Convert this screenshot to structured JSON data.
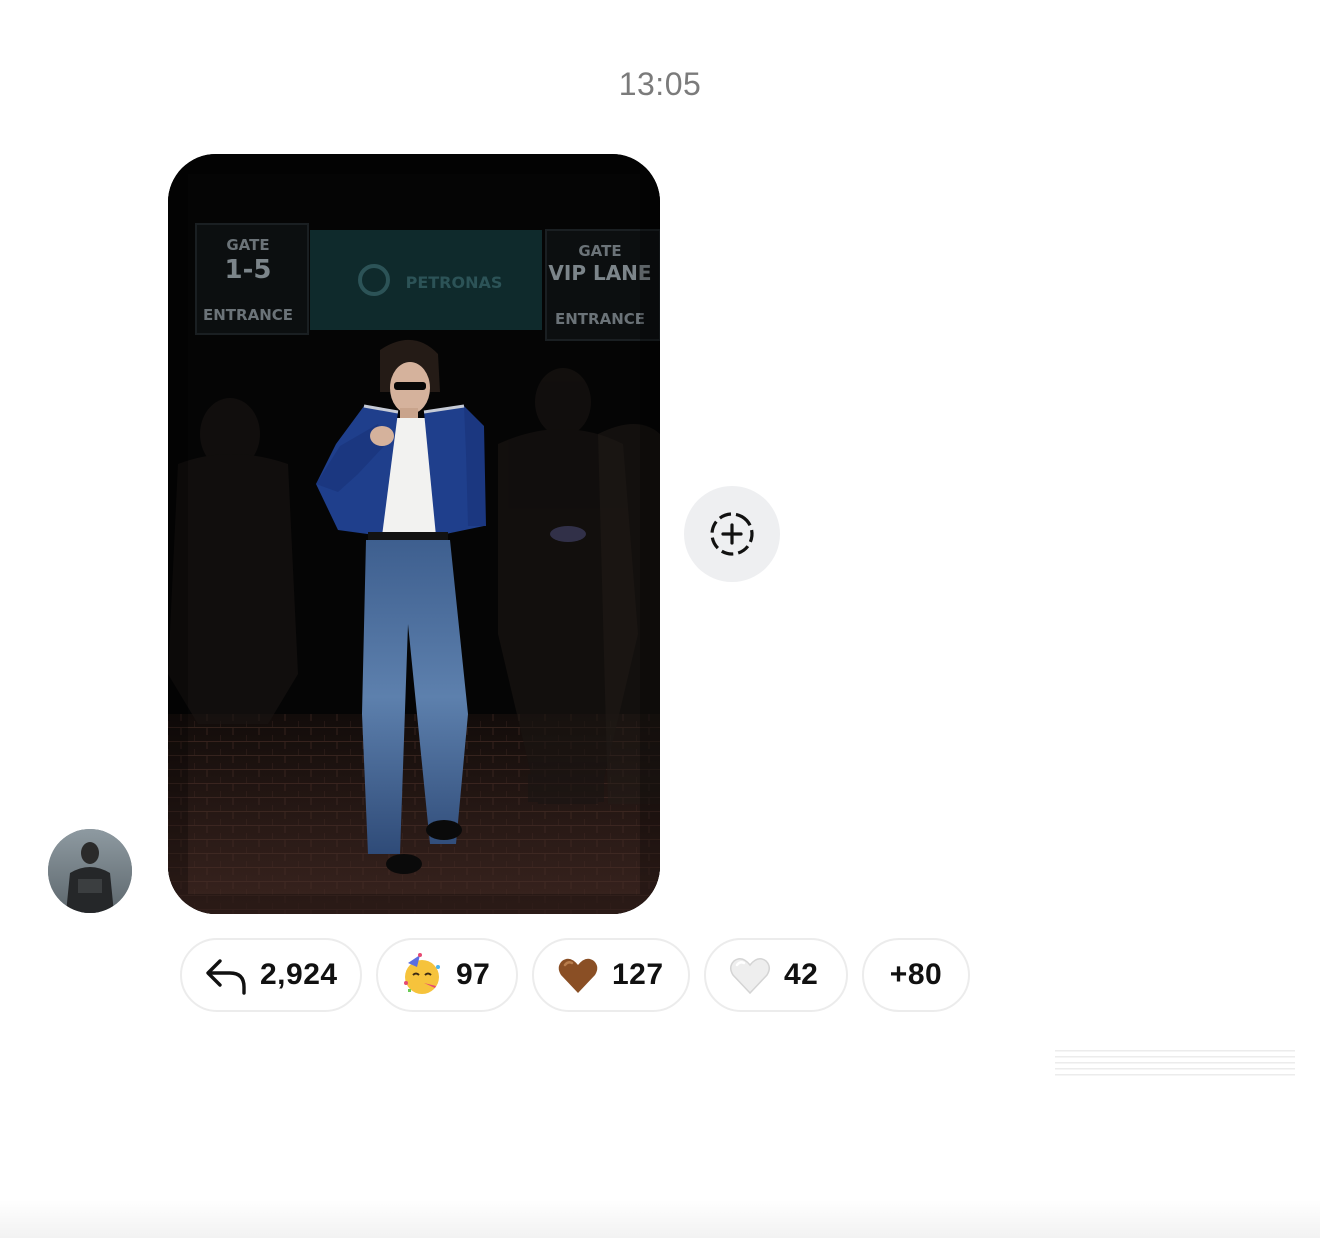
{
  "message": {
    "timestamp": "13:05",
    "photo": {
      "signs": {
        "left_gate": "GATE",
        "left_number": "1-5",
        "left_entrance": "ENTRANCE",
        "center_brand": "PETRONAS",
        "right_gate": "GATE",
        "right_lane": "VIP LANE",
        "right_entrance": "ENTRANCE"
      }
    }
  },
  "reactions": [
    {
      "icon": "reply-arrow-icon",
      "count": "2,924"
    },
    {
      "icon": "partying-face-emoji",
      "count": "97"
    },
    {
      "icon": "brown-heart-emoji",
      "count": "127"
    },
    {
      "icon": "white-heart-emoji",
      "count": "42"
    },
    {
      "icon": null,
      "count": "+80"
    }
  ],
  "actions": {
    "share_icon": "add-to-story-icon"
  },
  "colors": {
    "timestamp": "#7b7b7b",
    "pill_border": "#ececec",
    "share_button_bg": "#eeeff1",
    "jacket_blue": "#1f3f8c",
    "brown_heart": "#8a4f25"
  }
}
